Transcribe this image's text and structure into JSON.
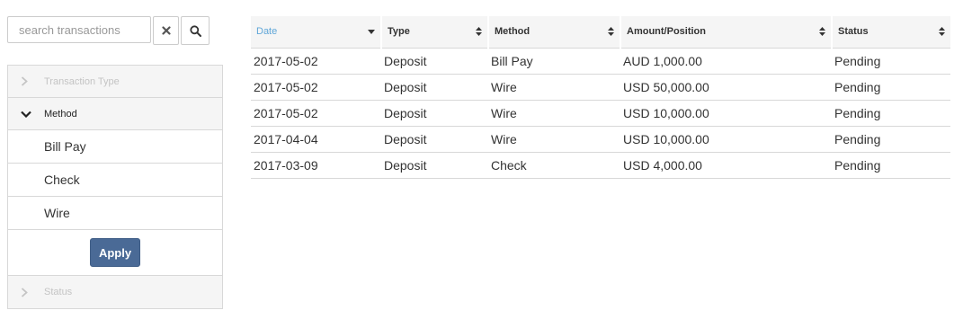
{
  "search": {
    "placeholder": "search transactions",
    "value": ""
  },
  "filters": {
    "sections": {
      "transaction_type": {
        "label": "Transaction Type",
        "state": "collapsed"
      },
      "method": {
        "label": "Method",
        "state": "expanded"
      },
      "status": {
        "label": "Status",
        "state": "collapsed"
      }
    },
    "method_options": [
      "Bill Pay",
      "Check",
      "Wire"
    ],
    "apply_label": "Apply"
  },
  "table": {
    "columns": [
      {
        "label": "Date",
        "sort": "desc-active"
      },
      {
        "label": "Type",
        "sort": "none"
      },
      {
        "label": "Method",
        "sort": "none"
      },
      {
        "label": "Amount/Position",
        "sort": "none"
      },
      {
        "label": "Status",
        "sort": "none"
      }
    ],
    "rows": [
      [
        "2017-05-02",
        "Deposit",
        "Bill Pay",
        "AUD 1,000.00",
        "Pending"
      ],
      [
        "2017-05-02",
        "Deposit",
        "Wire",
        "USD 50,000.00",
        "Pending"
      ],
      [
        "2017-05-02",
        "Deposit",
        "Wire",
        "USD 10,000.00",
        "Pending"
      ],
      [
        "2017-04-04",
        "Deposit",
        "Wire",
        "USD 10,000.00",
        "Pending"
      ],
      [
        "2017-03-09",
        "Deposit",
        "Check",
        "USD 4,000.00",
        "Pending"
      ]
    ]
  },
  "colors": {
    "accent": "#5fa6d8",
    "apply_button": "#4a6a96",
    "header_bg": "#f5f5f5",
    "border": "#d8d8d8"
  },
  "icons": {
    "clear": "times-icon",
    "search": "magnifier-icon",
    "collapsed": "chevron-right-icon",
    "expanded": "chevron-down-icon",
    "sort_active": "caret-down-icon",
    "sort_none": "sort-both-icon"
  }
}
